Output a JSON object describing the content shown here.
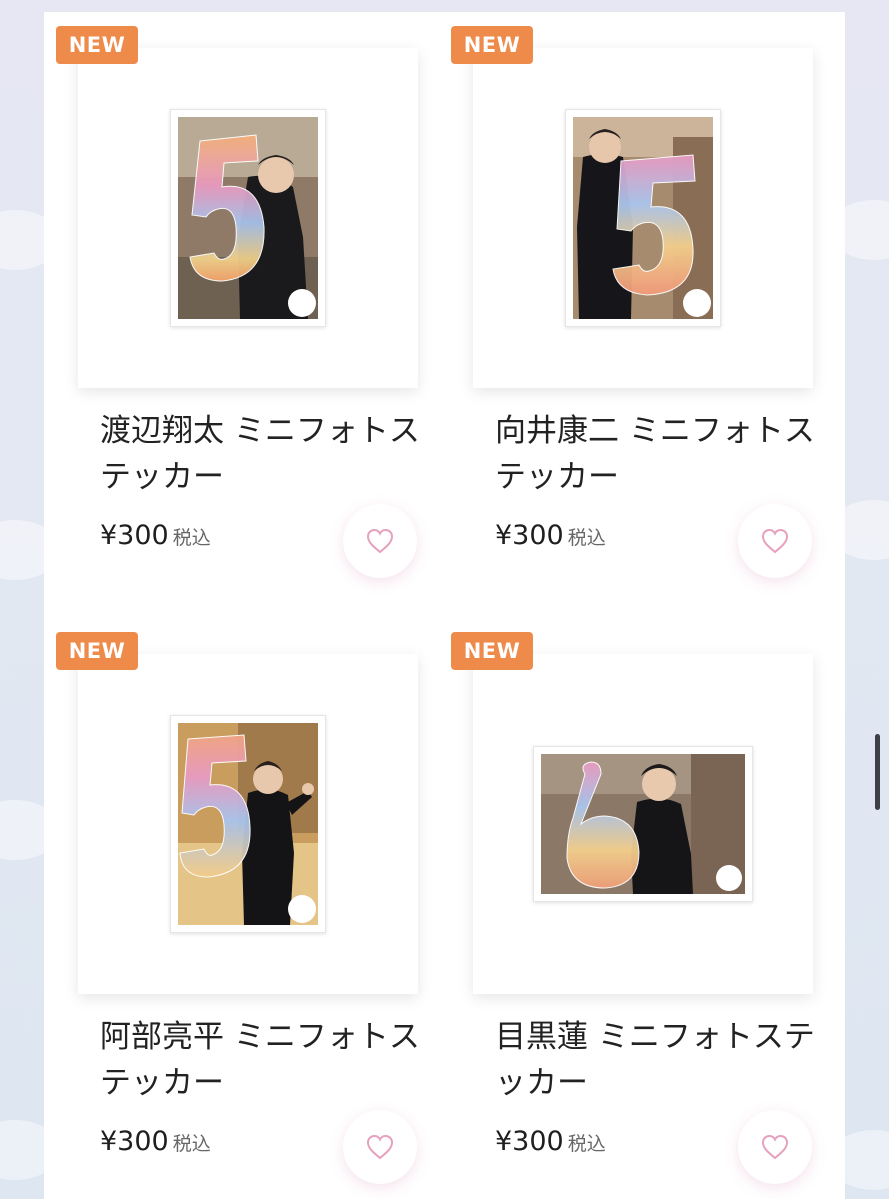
{
  "products": [
    {
      "badge": "NEW",
      "title": "渡辺翔太 ミニフォトステッカー",
      "price": "¥300",
      "tax": "税込",
      "orientation": "portrait"
    },
    {
      "badge": "NEW",
      "title": "向井康二 ミニフォトステッカー",
      "price": "¥300",
      "tax": "税込",
      "orientation": "portrait"
    },
    {
      "badge": "NEW",
      "title": "阿部亮平 ミニフォトステッカー",
      "price": "¥300",
      "tax": "税込",
      "orientation": "portrait"
    },
    {
      "badge": "NEW",
      "title": "目黒蓮 ミニフォトステッカー",
      "price": "¥300",
      "tax": "税込",
      "orientation": "landscape"
    }
  ],
  "icons": {
    "favorite": "heart-outline-icon"
  },
  "colors": {
    "badge": "#ee8a4a",
    "heart": "#e6a1bf",
    "background": "#e3e8f2"
  }
}
